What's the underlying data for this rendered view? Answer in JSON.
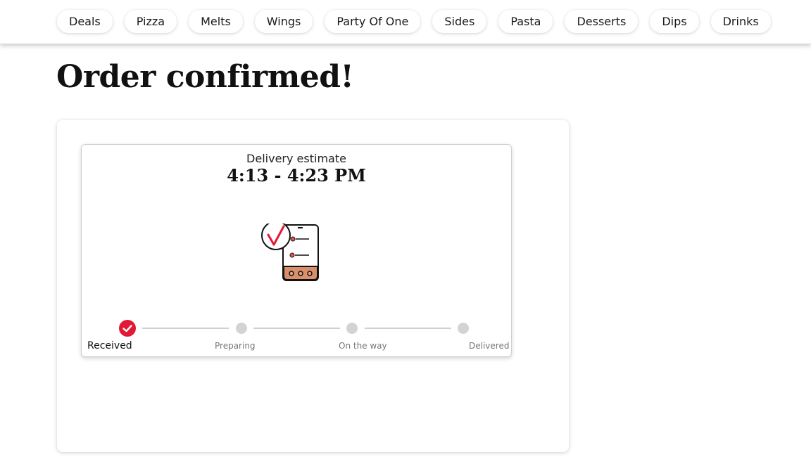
{
  "nav": {
    "items": [
      {
        "label": "Deals"
      },
      {
        "label": "Pizza"
      },
      {
        "label": "Melts"
      },
      {
        "label": "Wings"
      },
      {
        "label": "Party Of One"
      },
      {
        "label": "Sides"
      },
      {
        "label": "Pasta"
      },
      {
        "label": "Desserts"
      },
      {
        "label": "Dips"
      },
      {
        "label": "Drinks"
      }
    ]
  },
  "page": {
    "title": "Order confirmed!"
  },
  "delivery": {
    "label": "Delivery estimate",
    "time": "4:13 - 4:23 PM",
    "illustration_icon": "phone-order-check-icon"
  },
  "tracker": {
    "current_step": 1,
    "total_steps": 4,
    "steps": [
      {
        "label": "Received",
        "status": "complete"
      },
      {
        "label": "Preparing",
        "status": "pending"
      },
      {
        "label": "On the way",
        "status": "pending"
      },
      {
        "label": "Delivered",
        "status": "pending"
      }
    ],
    "colors": {
      "complete": "#e31837",
      "pending": "#d3d3d3"
    }
  }
}
